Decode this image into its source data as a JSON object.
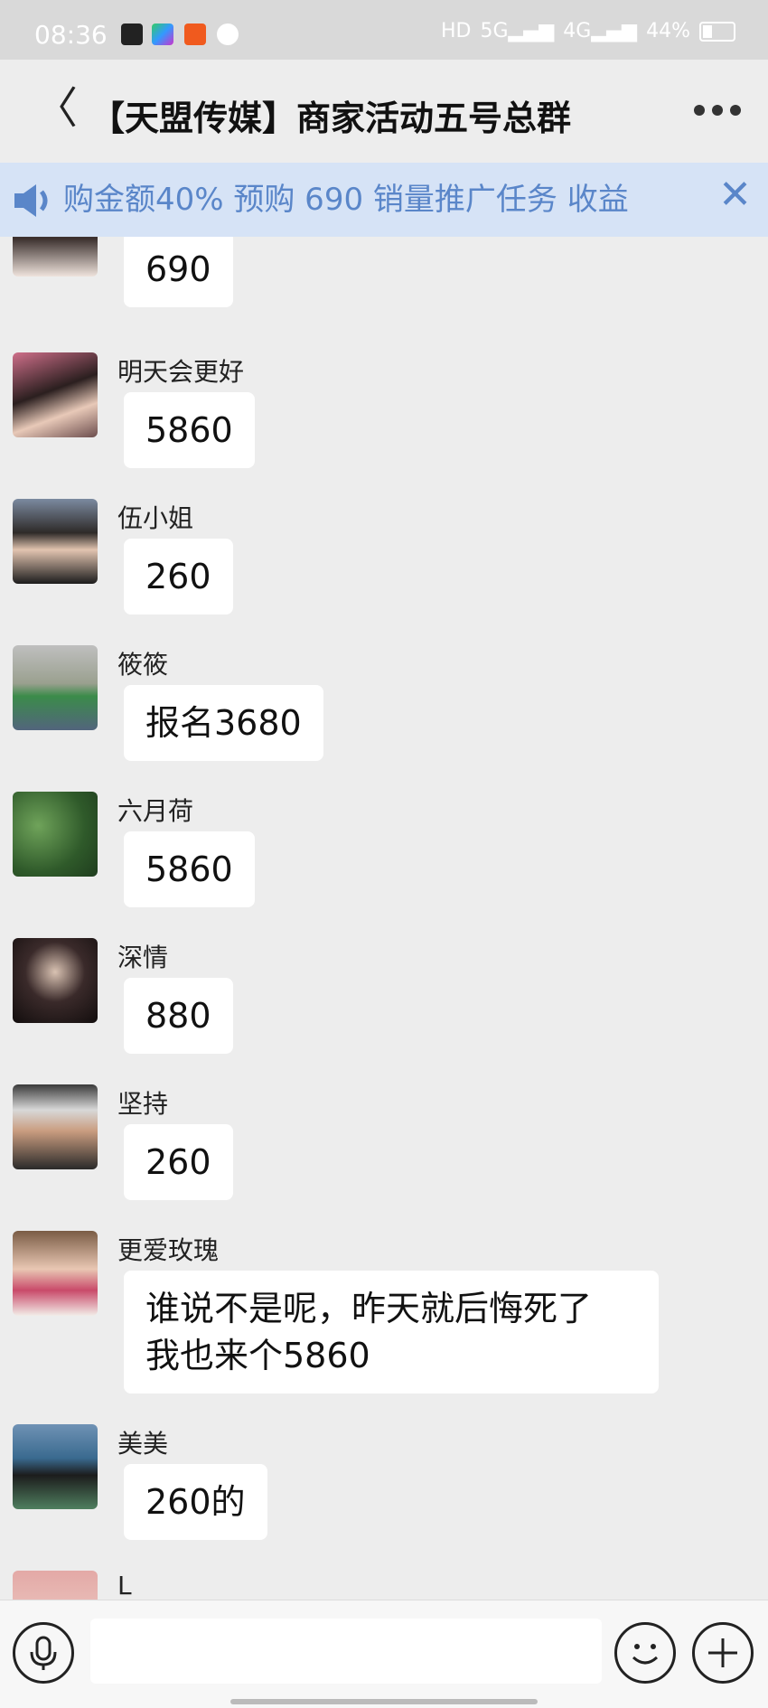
{
  "status_bar": {
    "time": "08:36",
    "network_labels": [
      "HD",
      "5G",
      "4G"
    ],
    "battery": "44%"
  },
  "header": {
    "back_icon": "chevron-left-icon",
    "title": "【天盟传媒】商家活动五号总群",
    "more_icon": "more-dots-icon"
  },
  "notice": {
    "text": "购金额40% 预购 690   销量推广任务   收益",
    "close_icon": "close-icon"
  },
  "messages": [
    {
      "name": "",
      "text": "690"
    },
    {
      "name": "明天会更好",
      "text": "5860"
    },
    {
      "name": "伍小姐",
      "text": "260"
    },
    {
      "name": "筱筱",
      "text": "报名3680"
    },
    {
      "name": "六月荷",
      "text": "5860"
    },
    {
      "name": "深情",
      "text": "880"
    },
    {
      "name": "坚持",
      "text": "260"
    },
    {
      "name": "更爱玫瑰",
      "text_line1": "谁说不是呢，昨天就后悔死了",
      "text_line2": "我也来个5860"
    },
    {
      "name": "美美",
      "text": "260的"
    },
    {
      "name": "L",
      "text": ""
    }
  ],
  "input_bar": {
    "voice_icon": "microphone-icon",
    "input_value": "",
    "emoji_icon": "smiley-icon",
    "plus_icon": "plus-icon"
  },
  "colors": {
    "background": "#ededed",
    "notice_bg": "#d6e3f6",
    "notice_text": "#5a86c9",
    "bubble": "#ffffff"
  }
}
